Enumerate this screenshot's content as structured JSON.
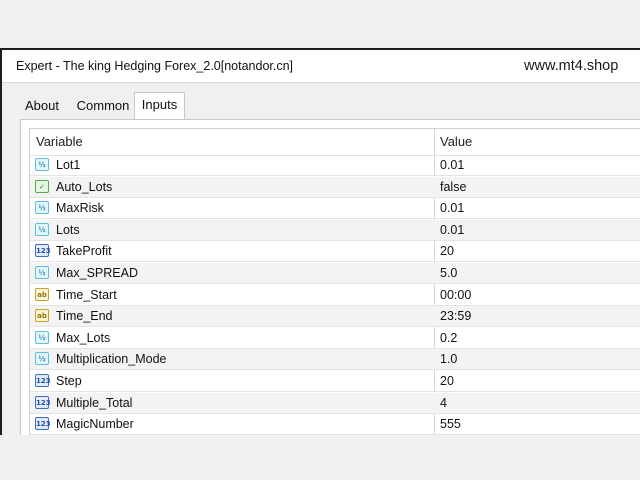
{
  "window": {
    "title": "Expert - The king Hedging Forex_2.0[notandor.cn]",
    "watermark": "www.mt4.shop"
  },
  "tabs": [
    {
      "label": "About"
    },
    {
      "label": "Common"
    },
    {
      "label": "Inputs",
      "active": true
    }
  ],
  "table": {
    "headers": {
      "variable": "Variable",
      "value": "Value"
    },
    "rows": [
      {
        "name": "Lot1",
        "value": "0.01",
        "type_icon": "double-icon"
      },
      {
        "name": "Auto_Lots",
        "value": "false",
        "type_icon": "bool-icon"
      },
      {
        "name": "MaxRisk",
        "value": "0.01",
        "type_icon": "double-icon"
      },
      {
        "name": "Lots",
        "value": "0.01",
        "type_icon": "double-icon"
      },
      {
        "name": "TakeProfit",
        "value": "20",
        "type_icon": "int-icon"
      },
      {
        "name": "Max_SPREAD",
        "value": "5.0",
        "type_icon": "double-icon"
      },
      {
        "name": "Time_Start",
        "value": "00:00",
        "type_icon": "string-icon"
      },
      {
        "name": "Time_End",
        "value": "23:59",
        "type_icon": "string-icon"
      },
      {
        "name": "Max_Lots",
        "value": "0.2",
        "type_icon": "double-icon"
      },
      {
        "name": "Multiplication_Mode",
        "value": "1.0",
        "type_icon": "double-icon"
      },
      {
        "name": "Step",
        "value": "20",
        "type_icon": "int-icon"
      },
      {
        "name": "Multiple_Total",
        "value": "4",
        "type_icon": "int-icon"
      },
      {
        "name": "MagicNumber",
        "value": "555",
        "type_icon": "int-icon"
      }
    ]
  },
  "colors": {
    "window_border": "#1e1e1e",
    "alt_row": "#f3f3f3",
    "panel_bg": "#ffffff"
  }
}
